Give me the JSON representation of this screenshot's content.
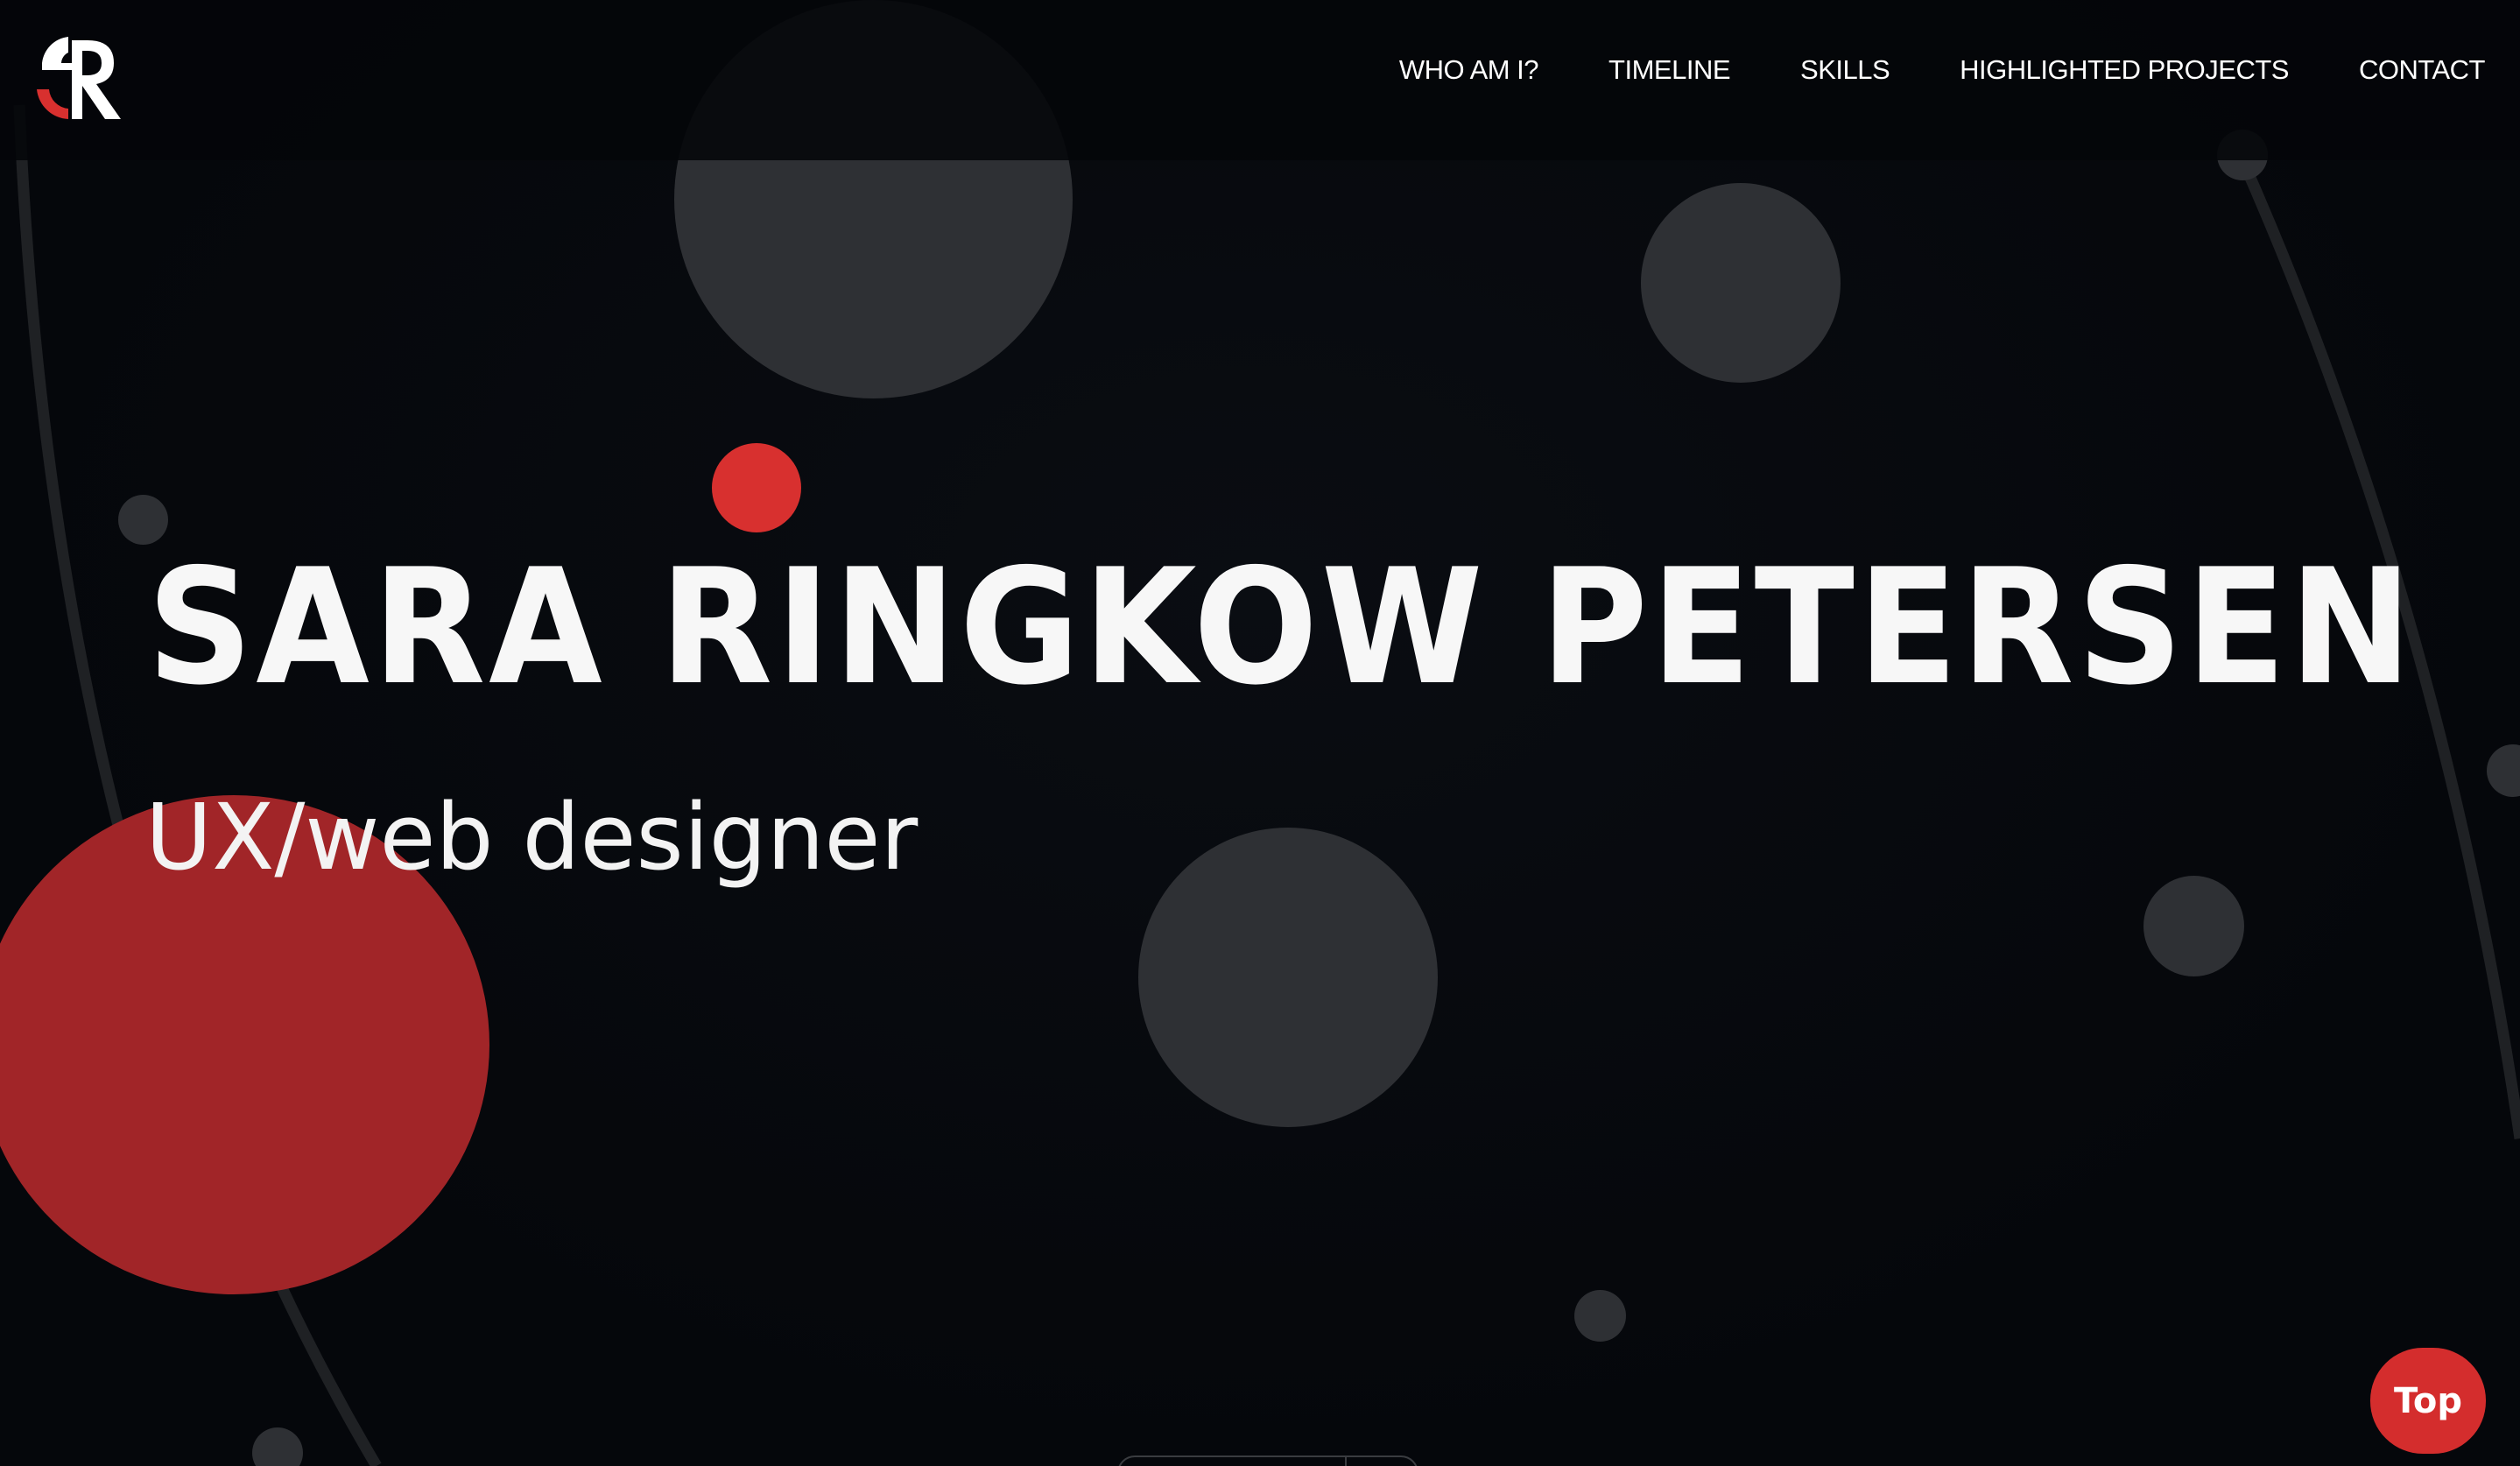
{
  "header": {
    "logo_icon": "sr-monogram-logo",
    "nav": [
      {
        "label": "WHO AM I?"
      },
      {
        "label": "TIMELINE"
      },
      {
        "label": "SKILLS"
      },
      {
        "label": "HIGHLIGHTED PROJECTS"
      },
      {
        "label": "CONTACT"
      }
    ]
  },
  "hero": {
    "name": "SARA RINGKOW PETERSEN",
    "role": "UX/web designer"
  },
  "top_button": {
    "label": "Top"
  },
  "colors": {
    "background": "#05070b",
    "accent_red": "#d8302f",
    "dark_red": "#a12528",
    "bubble_gray": "#2e3034",
    "text": "#ffffff"
  }
}
